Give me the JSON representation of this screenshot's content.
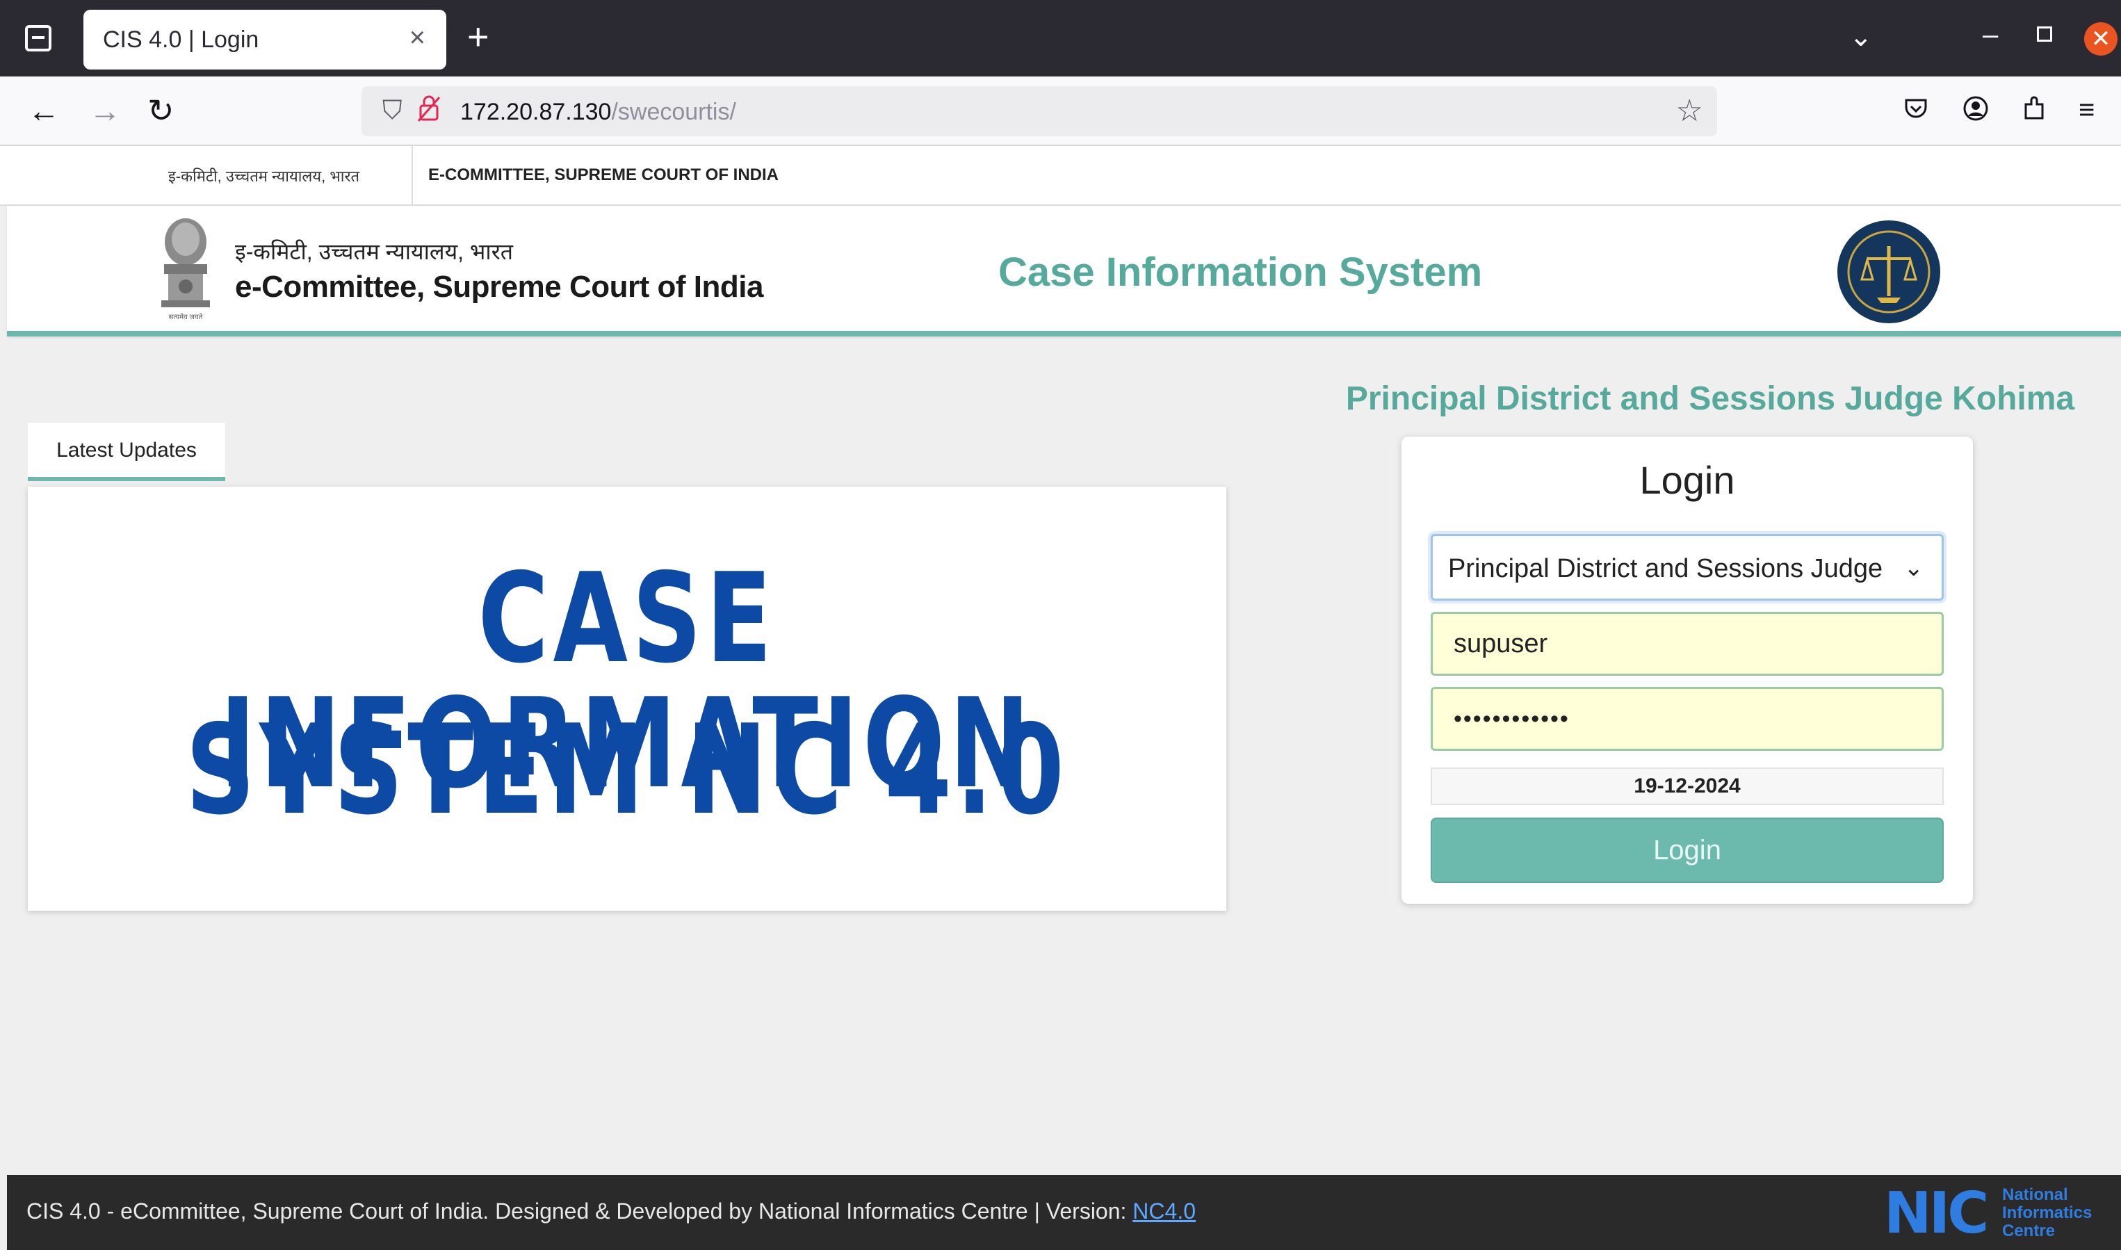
{
  "browser": {
    "tab_title": "CIS 4.0 | Login",
    "tab_close": "×",
    "new_tab": "+",
    "url_host": "172.20.87.130",
    "url_path": "/swecourtis/"
  },
  "topstrip": {
    "hindi": "इ-कमिटी, उच्चतम न्यायालय, भारत",
    "english": "E-COMMITTEE, SUPREME COURT OF INDIA"
  },
  "header": {
    "org_hindi": "इ-कमिटी, उच्चतम न्यायालय, भारत",
    "org_english": "e-Committee, Supreme Court of India",
    "app_name": "Case Information System",
    "emblem_caption": "सत्यमेव जयते"
  },
  "updates": {
    "tab_label": "Latest Updates",
    "banner_line1": "CASE INFORMATION",
    "banner_line2": "SYSTEM NC 4.0"
  },
  "login": {
    "court_name": "Principal District and Sessions Judge Kohima",
    "heading": "Login",
    "court_select_value": "Principal District and Sessions Judge",
    "username_value": "supuser",
    "password_masked": "••••••••••••",
    "date": "19-12-2024",
    "button_label": "Login"
  },
  "footer": {
    "text": "CIS 4.0 - eCommittee, Supreme Court of India. Designed & Developed by National Informatics Centre | Version: ",
    "version_link": "NC4.0",
    "nic_mark": "NIC",
    "nic_line1": "National",
    "nic_line2": "Informatics",
    "nic_line3": "Centre"
  },
  "colors": {
    "accent": "#55aa9c",
    "banner_blue": "#0c4aa6",
    "footer_bg": "#2a2a2a",
    "input_bg": "#ffffd8"
  }
}
